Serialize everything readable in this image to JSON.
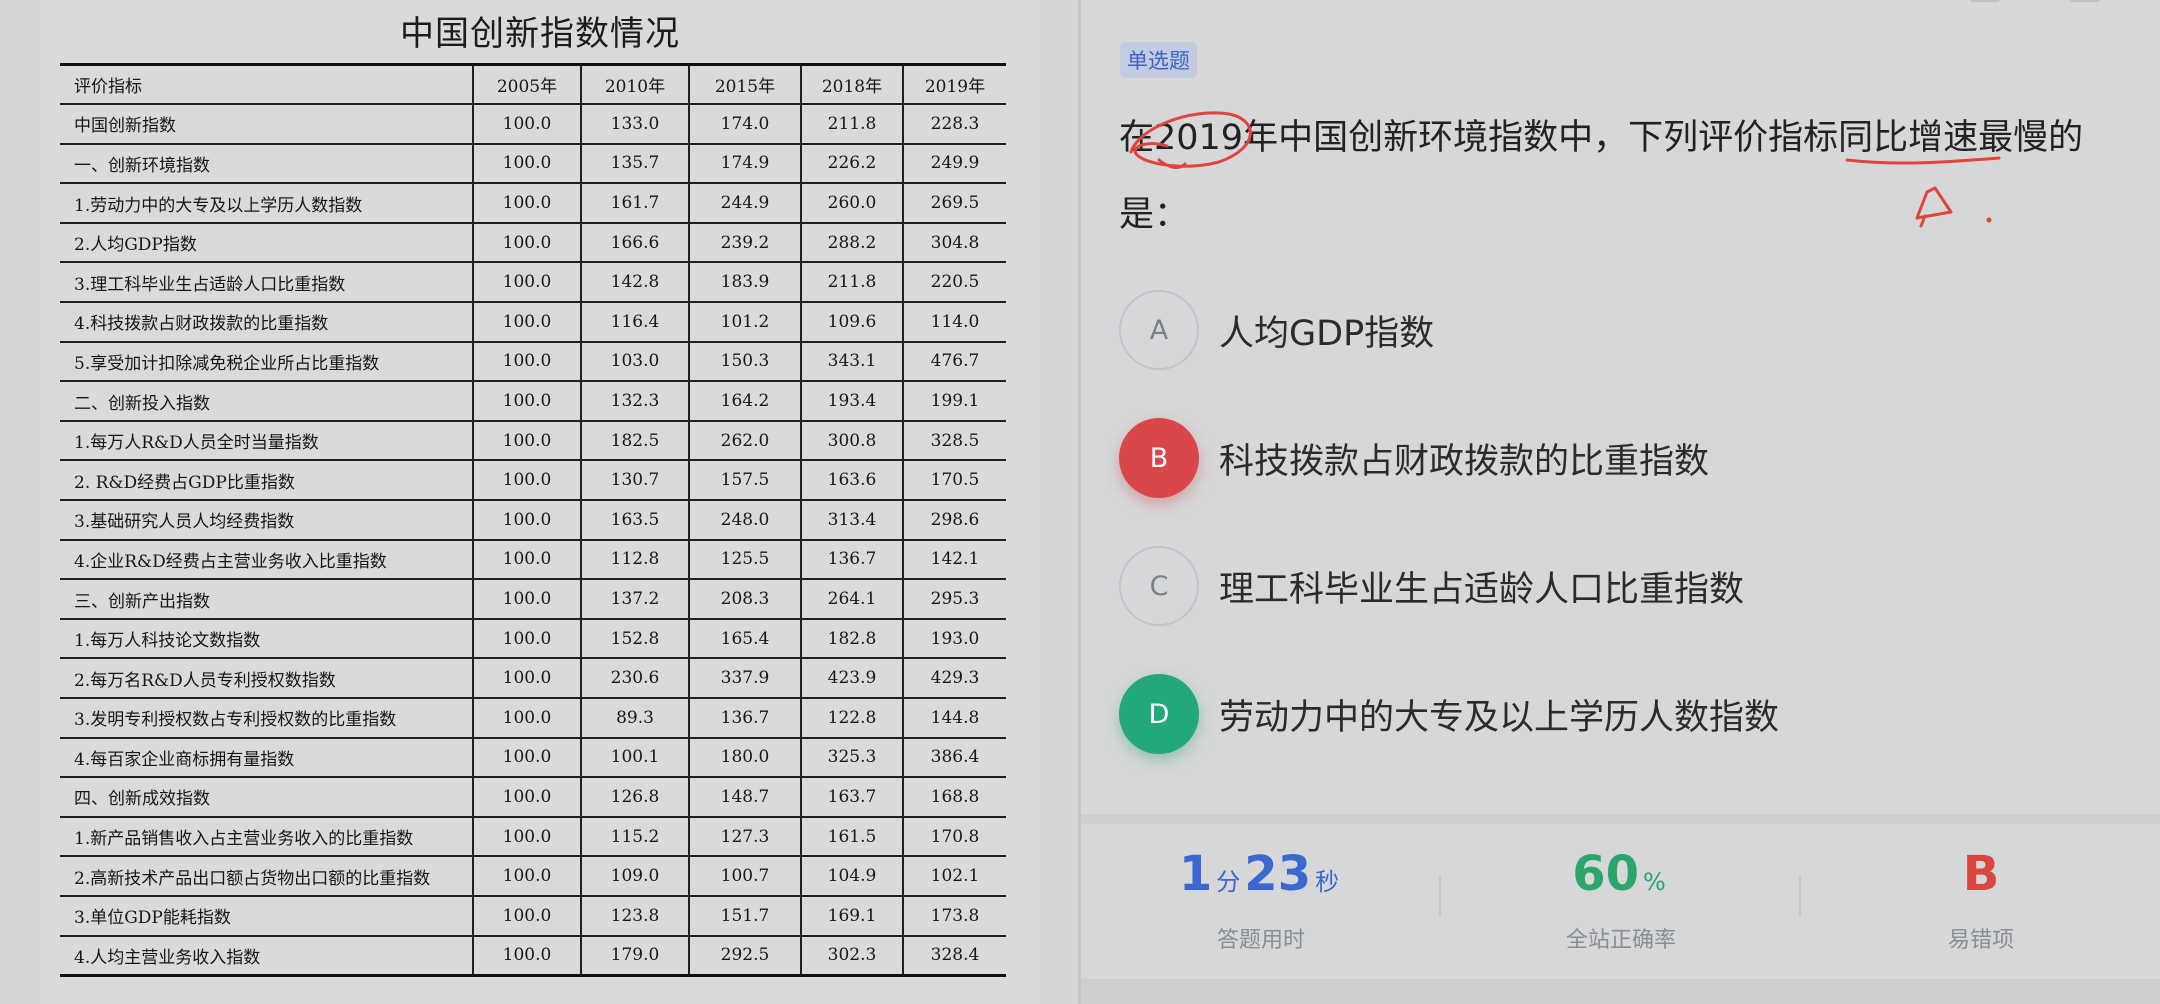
{
  "table": {
    "title": "中国创新指数情况",
    "headers": [
      "评价指标",
      "2005年",
      "2010年",
      "2015年",
      "2018年",
      "2019年"
    ],
    "rows": [
      {
        "name": "中国创新指数",
        "v": [
          "100.0",
          "133.0",
          "174.0",
          "211.8",
          "228.3"
        ]
      },
      {
        "name": "一、创新环境指数",
        "v": [
          "100.0",
          "135.7",
          "174.9",
          "226.2",
          "249.9"
        ]
      },
      {
        "name": "1.劳动力中的大专及以上学历人数指数",
        "v": [
          "100.0",
          "161.7",
          "244.9",
          "260.0",
          "269.5"
        ]
      },
      {
        "name": "2.人均GDP指数",
        "v": [
          "100.0",
          "166.6",
          "239.2",
          "288.2",
          "304.8"
        ]
      },
      {
        "name": "3.理工科毕业生占适龄人口比重指数",
        "v": [
          "100.0",
          "142.8",
          "183.9",
          "211.8",
          "220.5"
        ]
      },
      {
        "name": "4.科技拨款占财政拨款的比重指数",
        "v": [
          "100.0",
          "116.4",
          "101.2",
          "109.6",
          "114.0"
        ]
      },
      {
        "name": "5.享受加计扣除减免税企业所占比重指数",
        "v": [
          "100.0",
          "103.0",
          "150.3",
          "343.1",
          "476.7"
        ]
      },
      {
        "name": "二、创新投入指数",
        "v": [
          "100.0",
          "132.3",
          "164.2",
          "193.4",
          "199.1"
        ]
      },
      {
        "name": "1.每万人R&D人员全时当量指数",
        "v": [
          "100.0",
          "182.5",
          "262.0",
          "300.8",
          "328.5"
        ]
      },
      {
        "name": "2. R&D经费占GDP比重指数",
        "v": [
          "100.0",
          "130.7",
          "157.5",
          "163.6",
          "170.5"
        ]
      },
      {
        "name": "3.基础研究人员人均经费指数",
        "v": [
          "100.0",
          "163.5",
          "248.0",
          "313.4",
          "298.6"
        ]
      },
      {
        "name": "4.企业R&D经费占主营业务收入比重指数",
        "v": [
          "100.0",
          "112.8",
          "125.5",
          "136.7",
          "142.1"
        ]
      },
      {
        "name": "三、创新产出指数",
        "v": [
          "100.0",
          "137.2",
          "208.3",
          "264.1",
          "295.3"
        ]
      },
      {
        "name": "1.每万人科技论文数指数",
        "v": [
          "100.0",
          "152.8",
          "165.4",
          "182.8",
          "193.0"
        ]
      },
      {
        "name": "2.每万名R&D人员专利授权数指数",
        "v": [
          "100.0",
          "230.6",
          "337.9",
          "423.9",
          "429.3"
        ]
      },
      {
        "name": "3.发明专利授权数占专利授权数的比重指数",
        "v": [
          "100.0",
          "89.3",
          "136.7",
          "122.8",
          "144.8"
        ]
      },
      {
        "name": "4.每百家企业商标拥有量指数",
        "v": [
          "100.0",
          "100.1",
          "180.0",
          "325.3",
          "386.4"
        ]
      },
      {
        "name": "四、创新成效指数",
        "v": [
          "100.0",
          "126.8",
          "148.7",
          "163.7",
          "168.8"
        ]
      },
      {
        "name": "1.新产品销售收入占主营业务收入的比重指数",
        "v": [
          "100.0",
          "115.2",
          "127.3",
          "161.5",
          "170.8"
        ]
      },
      {
        "name": "2.高新技术产品出口额占货物出口额的比重指数",
        "v": [
          "100.0",
          "109.0",
          "100.7",
          "104.9",
          "102.1"
        ]
      },
      {
        "name": "3.单位GDP能耗指数",
        "v": [
          "100.0",
          "123.8",
          "151.7",
          "169.1",
          "173.8"
        ]
      },
      {
        "name": "4.人均主营业务收入指数",
        "v": [
          "100.0",
          "179.0",
          "292.5",
          "302.3",
          "328.4"
        ]
      }
    ]
  },
  "question": {
    "type_badge": "单选题",
    "stem_line1": "在2019年中国创新环境指数中，下列评价指标同比增速最慢的",
    "stem_line2": "是：",
    "options": [
      {
        "letter": "A",
        "text": "人均GDP指数",
        "state": "normal"
      },
      {
        "letter": "B",
        "text": "科技拨款占财政拨款的比重指数",
        "state": "wrong"
      },
      {
        "letter": "C",
        "text": "理工科毕业生占适龄人口比重指数",
        "state": "normal"
      },
      {
        "letter": "D",
        "text": "劳动力中的大专及以上学历人数指数",
        "state": "right"
      }
    ]
  },
  "stats": {
    "time_minutes": "1",
    "time_minutes_unit": "分",
    "time_seconds": "23",
    "time_seconds_unit": "秒",
    "time_label": "答题用时",
    "accuracy_value": "60",
    "accuracy_unit": "%",
    "accuracy_label": "全站正确率",
    "common_wrong": "B",
    "common_wrong_label": "易错项"
  },
  "colors": {
    "wrong": "#d9474b",
    "right": "#22a87c",
    "accent_blue": "#3b68d0",
    "annotation": "#e0443c"
  }
}
